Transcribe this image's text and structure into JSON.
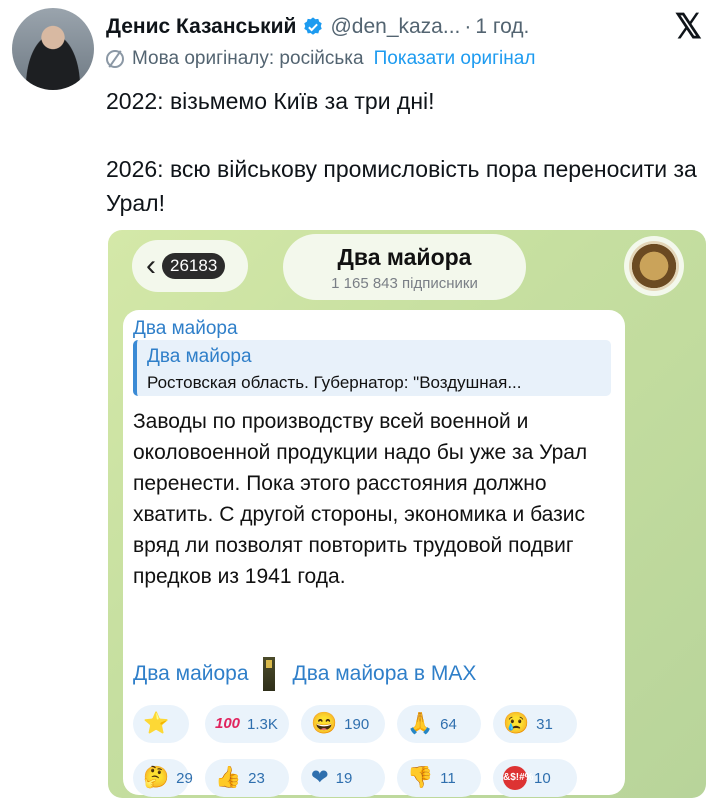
{
  "tweet": {
    "author_name": "Денис Казанський",
    "handle": "@den_kaza...",
    "separator": "·",
    "time": "1 год.",
    "language_note": "Мова оригіналу: російська",
    "show_original": "Показати оригінал",
    "text_lines": [
      "2022: візьмемо Київ за три дні!",
      "2026: всю військову промисловість пора переносити за Урал!"
    ]
  },
  "telegram": {
    "unread_count": "26183",
    "channel_title": "Два майора",
    "subscribers": "1 165 843 підписники",
    "message": {
      "sender": "Два майора",
      "reply_author": "Два майора",
      "reply_text": "Ростовская область. Губернатор: \"Воздушная...",
      "body": "Заводы по производству всей военной и околовоенной продукции надо бы уже за Урал перенести. Пока этого расстояния должно хватить. С другой стороны, экономика и базис вряд ли позволят повторить трудовой подвиг предков из 1941 года.",
      "link_1": "Два майора",
      "link_2": "Два майора в MAX"
    },
    "reactions": [
      {
        "icon": "⭐",
        "name": "star-icon",
        "count": ""
      },
      {
        "icon": "100",
        "name": "hundred-icon",
        "count": "1.3K"
      },
      {
        "icon": "😄",
        "name": "grinning-face-icon",
        "count": "190"
      },
      {
        "icon": "🙏",
        "name": "folded-hands-icon",
        "count": "64"
      },
      {
        "icon": "😢",
        "name": "crying-face-icon",
        "count": "31"
      },
      {
        "icon": "🤔",
        "name": "thinking-face-icon",
        "count": "29"
      },
      {
        "icon": "👍",
        "name": "thumbs-up-icon",
        "count": "23"
      },
      {
        "icon": "❤",
        "name": "heart-icon",
        "count": "19"
      },
      {
        "icon": "👎",
        "name": "thumbs-down-icon",
        "count": "11"
      },
      {
        "icon": "&$!#%",
        "name": "angry-face-icon",
        "count": "10"
      }
    ]
  },
  "colors": {
    "link_blue": "#1d9bf0",
    "telegram_blue": "#2f7fc9",
    "verified_blue": "#1d9bf0",
    "telegram_background": "#c6dfa0"
  }
}
